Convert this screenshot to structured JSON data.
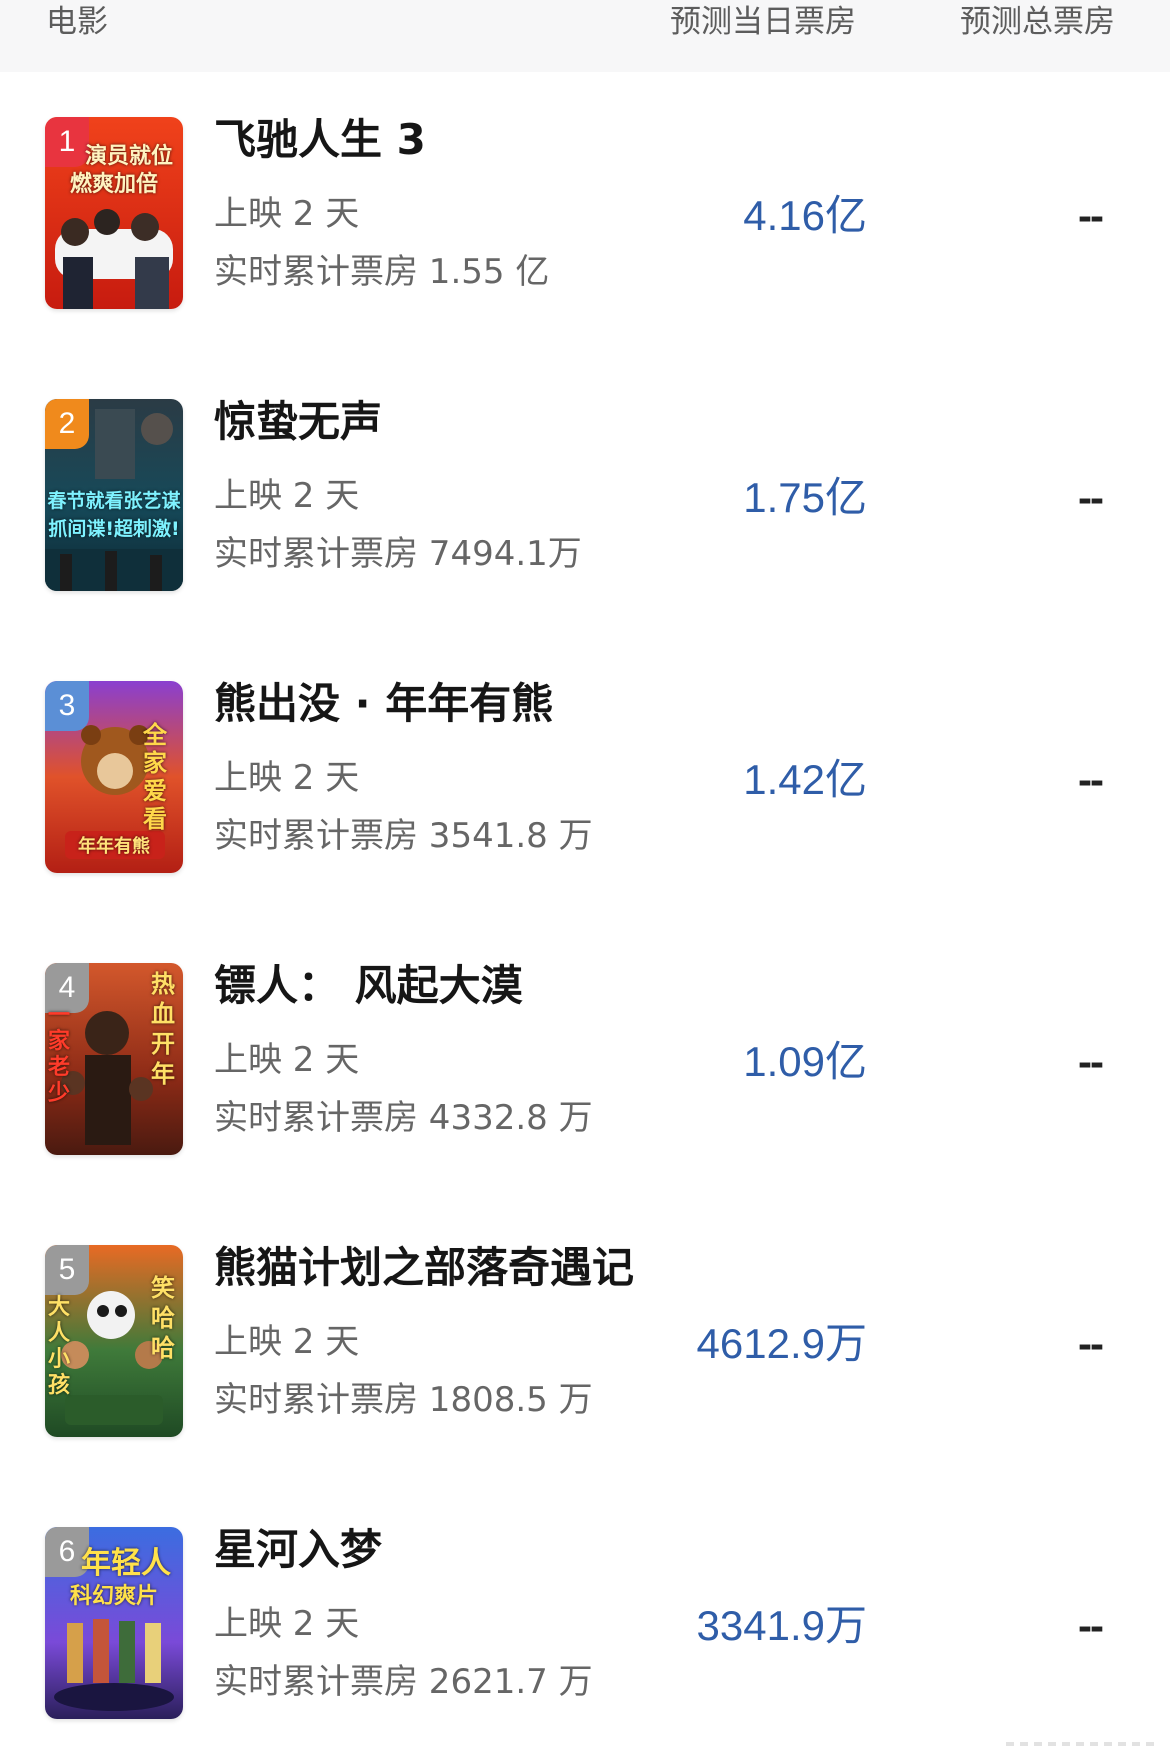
{
  "header": {
    "movie": "电影",
    "today_forecast": "预测当日票房",
    "total_forecast": "预测总票房"
  },
  "movies": [
    {
      "rank": "1",
      "title": "飞驰人生 3",
      "days": "上映 2 天",
      "cumulative": "实时累计票房 1.55 亿",
      "today": "4.16亿",
      "total": "--",
      "rank_color": "#e8343f",
      "poster_lines": [
        "演员就位",
        "燃爽加倍"
      ]
    },
    {
      "rank": "2",
      "title": "惊蛰无声",
      "days": "上映 2 天",
      "cumulative": "实时累计票房 7494.1万",
      "today": "1.75亿",
      "total": "--",
      "rank_color": "#f08a1c",
      "poster_lines": [
        "春节就看张艺谋",
        "抓间谍!超刺激!"
      ]
    },
    {
      "rank": "3",
      "title": "熊出没 · 年年有熊",
      "days": "上映 2 天",
      "cumulative": "实时累计票房 3541.8 万",
      "today": "1.42亿",
      "total": "--",
      "rank_color": "#5b8fd6",
      "poster_lines": [
        "全家爱看",
        "年年有熊"
      ]
    },
    {
      "rank": "4",
      "title": "镖人： 风起大漠",
      "days": "上映 2 天",
      "cumulative": "实时累计票房 4332.8 万",
      "today": "1.09亿",
      "total": "--",
      "rank_color": "#9a9a9a",
      "poster_lines": [
        "热血开年",
        "一家老少"
      ]
    },
    {
      "rank": "5",
      "title": "熊猫计划之部落奇遇记",
      "days": "上映 2 天",
      "cumulative": "实时累计票房 1808.5 万",
      "today": "4612.9万",
      "total": "--",
      "rank_color": "#9a9a9a",
      "poster_lines": [
        "笑哈哈",
        "大人小孩"
      ]
    },
    {
      "rank": "6",
      "title": "星河入梦",
      "days": "上映 2 天",
      "cumulative": "实时累计票房 2621.7 万",
      "today": "3341.9万",
      "total": "--",
      "rank_color": "#9a9a9a",
      "poster_lines": [
        "年轻人",
        "科幻爽片"
      ]
    }
  ],
  "colors": {
    "forecast_blue": "#2f5da8",
    "header_bg": "#f7f7f8"
  }
}
